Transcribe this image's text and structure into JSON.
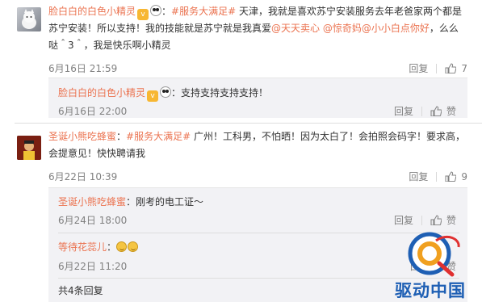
{
  "comments": [
    {
      "user": "脸白白的白色小精灵",
      "badge": "v",
      "sep": "：",
      "tag": "#服务大满足#",
      "text1": " 天津，我就是喜欢苏宁安装服务去年老爸家两个都是",
      "text2": "苏宁安装！所以支持！我的技能就是苏宁就是我真爱",
      "mention1": "@天天卖心",
      "mention2": "@惊奇妈",
      "mention3": "@小小白点你好",
      "text3": "，么么",
      "text4": "哒＾3＾，我是快乐啊小精灵",
      "time": "6月16日 21:59",
      "reply_label": "回复",
      "like_count": "7"
    },
    {
      "user": "圣诞小熊吃蜂蜜",
      "sep": "：",
      "tag": "#服务大满足#",
      "text1": " 广州！工科男，不怕晒！因为太白了！会拍照会码字！要求高，",
      "text2": "会提意见！快快聘请我",
      "time": "6月22日 10:39",
      "reply_label": "回复",
      "like_count": "9"
    }
  ],
  "replies": [
    {
      "user": "脸白白的白色小精灵",
      "sep": "：",
      "text": "支持支持支持支持！",
      "time": "6月16日 22:00",
      "reply_label": "回复",
      "like_label": "赞"
    },
    {
      "user": "圣诞小熊吃蜂蜜",
      "sep": "：",
      "text": "刚考的电工证～",
      "time": "6月24日 18:00",
      "reply_label": "回复",
      "like_label": "赞"
    },
    {
      "user": "等待花蕊儿",
      "sep": "：",
      "text": "",
      "time": "6月22日 11:20",
      "reply_label": "回复",
      "like_label": "赞"
    }
  ],
  "more_replies": "共4条回复",
  "watermark": "驱动中国",
  "colors": {
    "link": "#eb7350",
    "meta": "#808080",
    "sub_bg": "#f2f2f5"
  }
}
